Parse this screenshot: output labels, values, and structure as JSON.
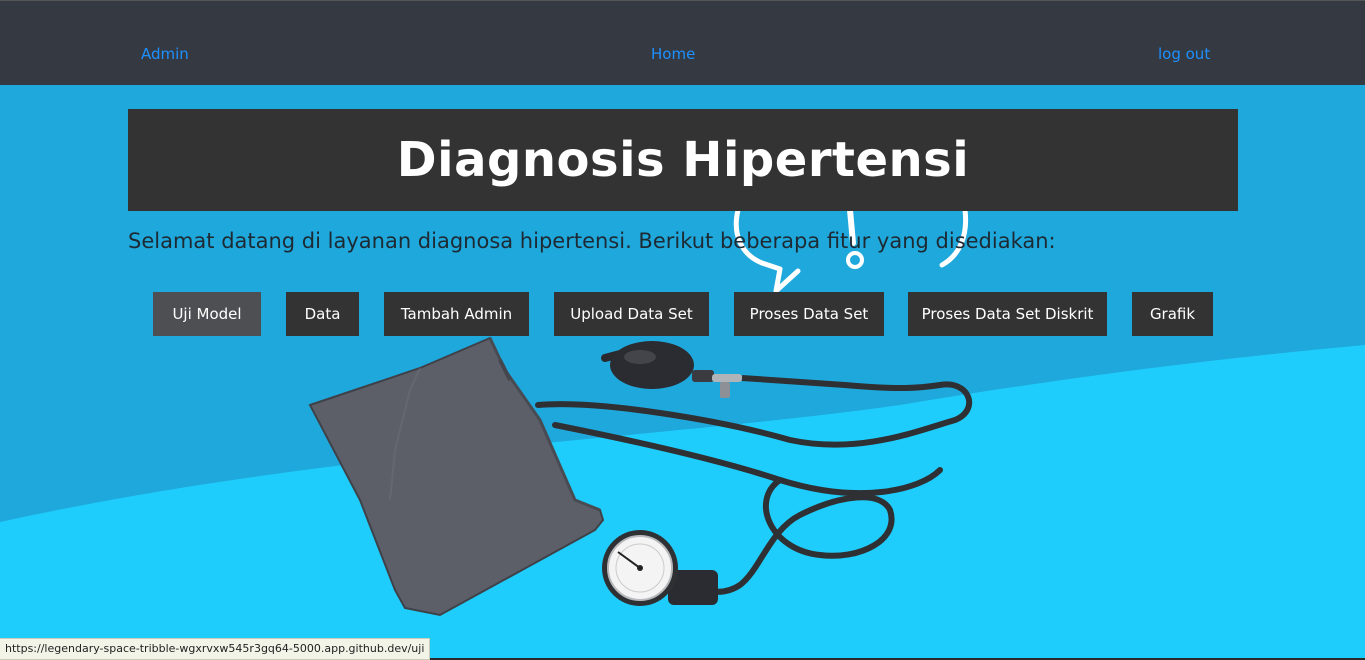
{
  "nav": {
    "admin": "Admin",
    "home": "Home",
    "logout": "log out"
  },
  "header": {
    "title": "Diagnosis Hipertensi"
  },
  "welcome_text": "Selamat datang di layanan diagnosa hipertensi. Berikut beberapa fitur yang disediakan:",
  "features": {
    "uji_model": "Uji Model",
    "data": "Data",
    "tambah_admin": "Tambah Admin",
    "upload_data_set": "Upload Data Set",
    "proses_data_set": "Proses Data Set",
    "proses_data_set_diskrit": "Proses Data Set Diskrit",
    "grafik": "Grafik"
  },
  "status_url": "https://legendary-space-tribble-wgxrvxw545r3gq64-5000.app.github.dev/uji",
  "colors": {
    "background_light": "#1fcdfc",
    "background_dark": "#1fa8dc",
    "navbar": "#353a42",
    "panel": "#333333",
    "link": "#1e90ff"
  },
  "illustration": {
    "main": "blood-pressure-monitor-image",
    "decoration": "exclamation-speech-bubble-icon"
  }
}
